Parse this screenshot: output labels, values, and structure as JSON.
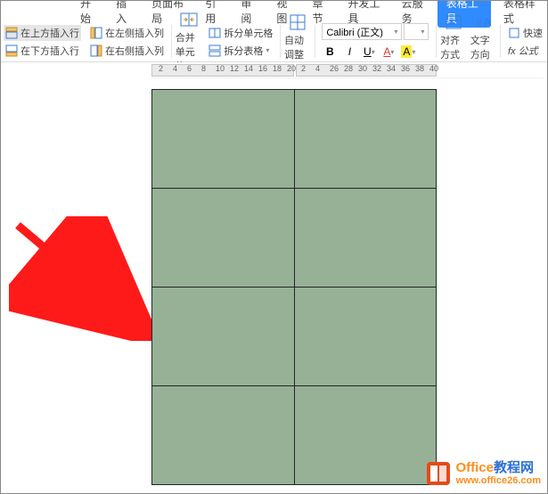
{
  "menubar": {
    "tabs": [
      "开始",
      "插入",
      "页面布局",
      "引用",
      "审阅",
      "视图",
      "章节",
      "开发工具",
      "云服务"
    ],
    "activeTab": "表格工具",
    "groupTab": "表格样式"
  },
  "toolbar": {
    "insertRowAbove": "在上方插入行",
    "insertRowBelow": "在下方插入行",
    "insertColLeft": "在左侧插入列",
    "insertColRight": "在右侧插入列",
    "mergeCells": "合并单元格",
    "splitCells": "拆分单元格",
    "splitTable": "拆分表格",
    "autoFit": "自动调整",
    "font": {
      "name": "Calibri (正文)",
      "size": ""
    },
    "bold": "B",
    "italic": "I",
    "underline": "U",
    "fontColorGlyph": "A",
    "highlightGlyph": "A",
    "align": "对齐方式",
    "textDir": "文字方向",
    "quick": "快速",
    "fx": "fx 公式"
  },
  "ruler": {
    "marks": [
      "2",
      "4",
      "6",
      "8",
      "10",
      "12",
      "14",
      "16",
      "18",
      "20",
      "2",
      "4",
      "26",
      "28",
      "30",
      "32",
      "34",
      "36",
      "38",
      "40"
    ]
  },
  "colors": {
    "tableFill": "#97b197",
    "tableBorder": "#1f2624",
    "arrow": "#ff1a1a",
    "ribbonActive": "#2f8bff"
  },
  "watermark": {
    "titlePrefix": "Office",
    "titleSuffix": "教程网",
    "url": "www.office26.com"
  },
  "table": {
    "rows": 4,
    "cols": 2
  }
}
